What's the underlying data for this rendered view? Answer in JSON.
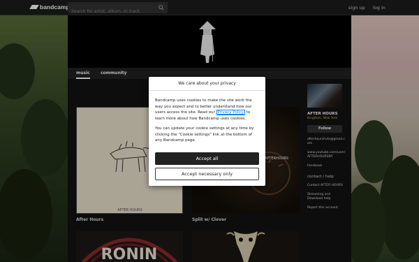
{
  "topbar": {
    "logo_text": "bandcamp",
    "search_placeholder": "Search for artist, album, or track",
    "signup_label": "sign up",
    "login_label": "log in"
  },
  "tabs": [
    {
      "label": "music"
    },
    {
      "label": "community"
    }
  ],
  "albums": [
    {
      "title": "After Hours",
      "cover_caption": "AFTER HOURS"
    },
    {
      "title": "Split w/ Clover",
      "cover_caption": "AFTERHOURS"
    },
    {
      "title": "",
      "cover_caption": "RONIN"
    },
    {
      "title": "",
      "cover_caption": ""
    }
  ],
  "sidebar": {
    "band_name": "AFTER HOURS",
    "location": "Kingston, New York",
    "follow_label": "Follow",
    "links": [
      "afterhourshvtc@gmail.com",
      "www.youtube.com/user/AFTERHOURSNY",
      "Facebook"
    ],
    "contact_heading": "contact / help",
    "help_links": [
      "Contact AFTER HOURS",
      "Streaming and Download help",
      "Report this account"
    ]
  },
  "modal": {
    "title": "We care about your privacy",
    "p1_before": "Bandcamp uses cookies to make the site work the way you expect and to better understand how our users access the site. Read our ",
    "privacy_link": "Privacy Policy",
    "p1_after": " to learn more about how Bandcamp uses cookies.",
    "p2": "You can update your cookie settings at any time by clicking the \"Cookie settings\" link at the bottom of any Bandcamp page.",
    "accept_all": "Accept all",
    "accept_necessary": "Accept necessary only"
  },
  "colors": {
    "link_blue": "#0687f5",
    "location_gold": "#d6b44a"
  }
}
